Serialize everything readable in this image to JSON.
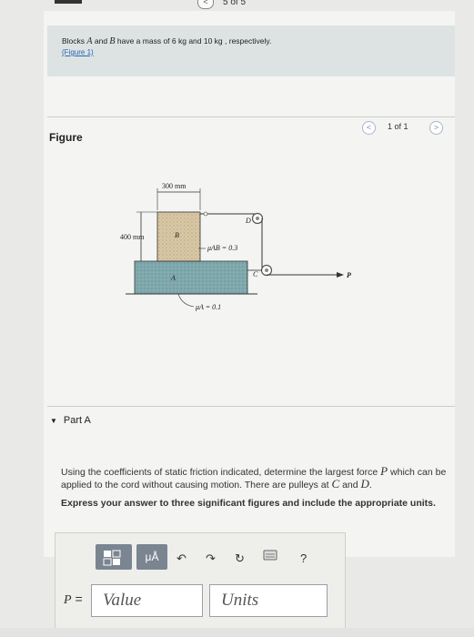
{
  "pager": {
    "prev_icon": "chevron-left-icon",
    "counter": "5 of 5"
  },
  "intro": {
    "text_before": "Blocks ",
    "block_a": "A",
    "text_mid": " and ",
    "block_b": "B",
    "text_after": " have a mass of 6 kg and 10 kg , respectively.",
    "figure_link": "(Figure 1)"
  },
  "figure": {
    "heading": "Figure",
    "counter": "1 of 1",
    "prev_icon": "chevron-left-icon",
    "next_icon": "chevron-right-icon",
    "diagram": {
      "dim_width": "300 mm",
      "dim_height": "400 mm",
      "label_b": "B",
      "label_a": "A",
      "label_d": "D",
      "label_c": "C",
      "label_p": "P",
      "mu_ab": "μAB = 0.3",
      "mu_a": "μA = 0.1"
    }
  },
  "part_a": {
    "title": "Part A",
    "question_1": "Using the coefficients of static friction indicated, determine the largest force ",
    "question_p": "P",
    "question_2": " which can be applied to the cord without causing motion. There are pulleys at ",
    "question_c": "C",
    "question_3": " and ",
    "question_d": "D",
    "question_4": ".",
    "instruction": "Express your answer to three significant figures and include the appropriate units."
  },
  "answer": {
    "mu_button": "μÅ",
    "help": "?",
    "variable": "P",
    "equals": " =",
    "value_placeholder": "Value",
    "units_placeholder": "Units"
  }
}
